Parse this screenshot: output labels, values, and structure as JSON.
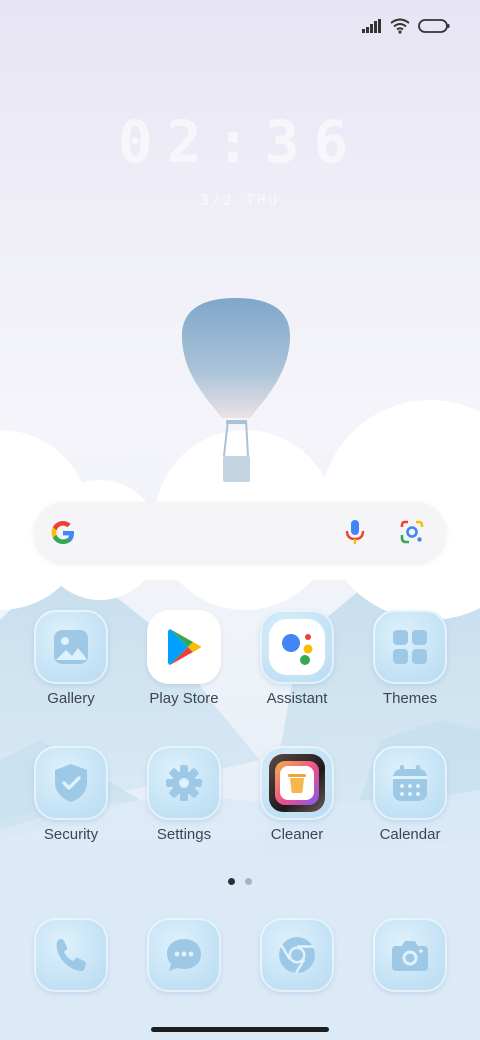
{
  "status_bar": {
    "signal_icon": "signal-bars-icon",
    "wifi_icon": "wifi-icon",
    "battery_icon": "battery-icon"
  },
  "lock_widget": {
    "time": "02:36",
    "date": "3/2 THU"
  },
  "search": {
    "google_icon": "google-g-icon",
    "mic_icon": "microphone-icon",
    "lens_icon": "google-lens-icon"
  },
  "apps": [
    {
      "label": "Gallery",
      "icon": "gallery-icon"
    },
    {
      "label": "Play Store",
      "icon": "play-store-icon"
    },
    {
      "label": "Assistant",
      "icon": "assistant-icon"
    },
    {
      "label": "Themes",
      "icon": "themes-icon"
    },
    {
      "label": "Security",
      "icon": "shield-check-icon"
    },
    {
      "label": "Settings",
      "icon": "gear-icon"
    },
    {
      "label": "Cleaner",
      "icon": "trash-icon"
    },
    {
      "label": "Calendar",
      "icon": "calendar-icon"
    }
  ],
  "page_indicator": {
    "pages": 2,
    "current": 1
  },
  "dock": [
    {
      "icon": "phone-icon"
    },
    {
      "icon": "message-icon"
    },
    {
      "icon": "chrome-icon"
    },
    {
      "icon": "camera-icon"
    }
  ],
  "colors": {
    "tile_icon": "#aad0ea",
    "label": "#3d4650",
    "accent_blue": "#4285f4",
    "accent_red": "#ea4335",
    "accent_yellow": "#fbbc05",
    "accent_green": "#34a853"
  }
}
